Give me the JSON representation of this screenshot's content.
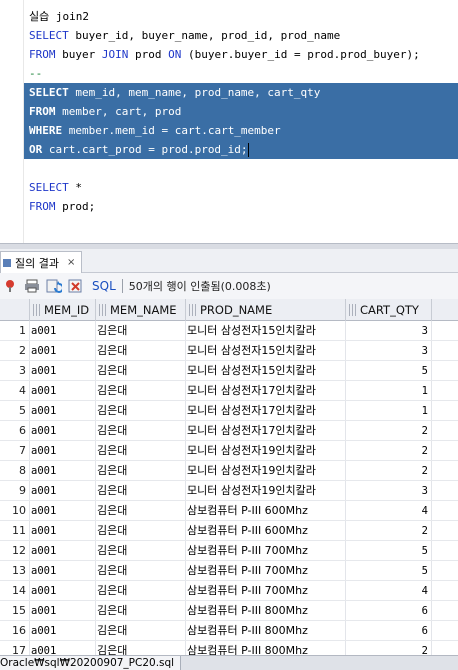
{
  "editor": {
    "lines": [
      {
        "parts": [
          {
            "t": "실습 join2",
            "k": ""
          }
        ]
      },
      {
        "parts": [
          {
            "t": "SELECT",
            "k": "kw"
          },
          {
            "t": " buyer_id, buyer_name, prod_id, prod_name",
            "k": ""
          }
        ]
      },
      {
        "parts": [
          {
            "t": "FROM",
            "k": "kw"
          },
          {
            "t": " buyer ",
            "k": ""
          },
          {
            "t": "JOIN",
            "k": "kw"
          },
          {
            "t": " prod ",
            "k": ""
          },
          {
            "t": "ON",
            "k": "kw"
          },
          {
            "t": " (buyer.buyer_id = prod.prod_buyer);",
            "k": ""
          }
        ]
      },
      {
        "parts": [
          {
            "t": "--",
            "k": "cm"
          }
        ]
      },
      {
        "sel": true,
        "parts": [
          {
            "t": "SELECT",
            "k": "kw"
          },
          {
            "t": " mem_id, mem_name, prod_name, cart_qty",
            "k": ""
          }
        ]
      },
      {
        "sel": true,
        "parts": [
          {
            "t": "FROM",
            "k": "kw"
          },
          {
            "t": " member, cart, prod",
            "k": ""
          }
        ]
      },
      {
        "sel": true,
        "parts": [
          {
            "t": "WHERE",
            "k": "kw"
          },
          {
            "t": " member.mem_id = cart.cart_member",
            "k": ""
          }
        ]
      },
      {
        "sel": true,
        "caret": true,
        "parts": [
          {
            "t": "OR",
            "k": "kw"
          },
          {
            "t": " cart.cart_prod = prod.prod_id;",
            "k": ""
          }
        ]
      },
      {
        "parts": []
      },
      {
        "parts": [
          {
            "t": "SELECT",
            "k": "kw"
          },
          {
            "t": " *",
            "k": ""
          }
        ]
      },
      {
        "parts": [
          {
            "t": "FROM",
            "k": "kw"
          },
          {
            "t": " prod;",
            "k": ""
          }
        ]
      }
    ]
  },
  "result_tab": {
    "label": "질의 결과",
    "close": "×"
  },
  "toolbar": {
    "sql_label": "SQL",
    "status": "50개의 행이 인출됨(0.008초)",
    "icons": [
      "pin-icon",
      "print-icon",
      "refresh-icon",
      "export-icon"
    ]
  },
  "grid": {
    "columns": [
      "MEM_ID",
      "MEM_NAME",
      "PROD_NAME",
      "CART_QTY"
    ],
    "rows": [
      {
        "n": "1",
        "id": "a001",
        "name": "김은대",
        "prod": "모니터 삼성전자15인치칼라",
        "qty": "3"
      },
      {
        "n": "2",
        "id": "a001",
        "name": "김은대",
        "prod": "모니터 삼성전자15인치칼라",
        "qty": "3"
      },
      {
        "n": "3",
        "id": "a001",
        "name": "김은대",
        "prod": "모니터 삼성전자15인치칼라",
        "qty": "5"
      },
      {
        "n": "4",
        "id": "a001",
        "name": "김은대",
        "prod": "모니터 삼성전자17인치칼라",
        "qty": "1"
      },
      {
        "n": "5",
        "id": "a001",
        "name": "김은대",
        "prod": "모니터 삼성전자17인치칼라",
        "qty": "1"
      },
      {
        "n": "6",
        "id": "a001",
        "name": "김은대",
        "prod": "모니터 삼성전자17인치칼라",
        "qty": "2"
      },
      {
        "n": "7",
        "id": "a001",
        "name": "김은대",
        "prod": "모니터 삼성전자19인치칼라",
        "qty": "2"
      },
      {
        "n": "8",
        "id": "a001",
        "name": "김은대",
        "prod": "모니터 삼성전자19인치칼라",
        "qty": "2"
      },
      {
        "n": "9",
        "id": "a001",
        "name": "김은대",
        "prod": "모니터 삼성전자19인치칼라",
        "qty": "3"
      },
      {
        "n": "10",
        "id": "a001",
        "name": "김은대",
        "prod": "삼보컴퓨터 P-III 600Mhz",
        "qty": "4"
      },
      {
        "n": "11",
        "id": "a001",
        "name": "김은대",
        "prod": "삼보컴퓨터 P-III 600Mhz",
        "qty": "2"
      },
      {
        "n": "12",
        "id": "a001",
        "name": "김은대",
        "prod": "삼보컴퓨터 P-III 700Mhz",
        "qty": "5"
      },
      {
        "n": "13",
        "id": "a001",
        "name": "김은대",
        "prod": "삼보컴퓨터 P-III 700Mhz",
        "qty": "5"
      },
      {
        "n": "14",
        "id": "a001",
        "name": "김은대",
        "prod": "삼보컴퓨터 P-III 700Mhz",
        "qty": "4"
      },
      {
        "n": "15",
        "id": "a001",
        "name": "김은대",
        "prod": "삼보컴퓨터 P-III 800Mhz",
        "qty": "6"
      },
      {
        "n": "16",
        "id": "a001",
        "name": "김은대",
        "prod": "삼보컴퓨터 P-III 800Mhz",
        "qty": "6"
      },
      {
        "n": "17",
        "id": "a001",
        "name": "김은대",
        "prod": "삼보컴퓨터 P-III 800Mhz",
        "qty": "2"
      }
    ]
  },
  "bottom_tab": {
    "label": "Oracle₩sql₩20200907_PC20.sql"
  },
  "colors": {
    "selection": "#3a6ea5",
    "keyword": "#1f37c9",
    "link": "#1a4fbf"
  }
}
